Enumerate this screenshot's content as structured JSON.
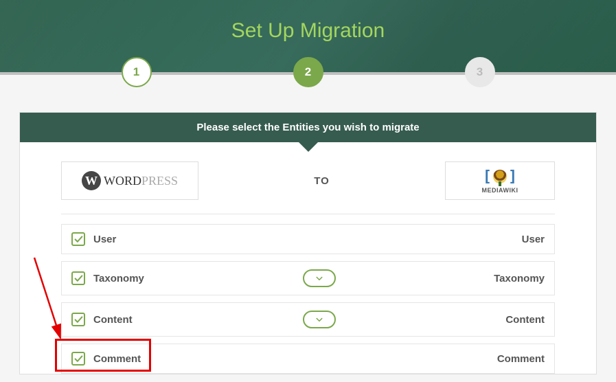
{
  "hero": {
    "title": "Set Up Migration"
  },
  "steps": [
    "1",
    "2",
    "3"
  ],
  "banner": {
    "text": "Please select the Entities you wish to migrate"
  },
  "platforms": {
    "source": {
      "name": "WORDPRESS",
      "word1": "WORD",
      "word2": "PRESS"
    },
    "to_label": "TO",
    "target": {
      "name": "MEDIAWIKI"
    }
  },
  "entities": [
    {
      "left": "User",
      "right": "User",
      "expandable": false
    },
    {
      "left": "Taxonomy",
      "right": "Taxonomy",
      "expandable": true
    },
    {
      "left": "Content",
      "right": "Content",
      "expandable": true
    },
    {
      "left": "Comment",
      "right": "Comment",
      "expandable": false
    }
  ],
  "colors": {
    "accent": "#7ba84a",
    "banner": "#365c4f",
    "highlight": "#e40000"
  }
}
